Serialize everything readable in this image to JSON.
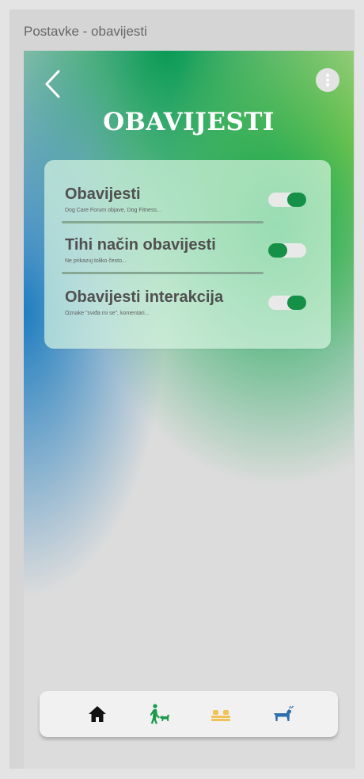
{
  "window": {
    "title": "Postavke - obavijesti"
  },
  "header": {
    "title": "OBAVIJESTI",
    "back_icon": "chevron-left-icon",
    "menu_icon": "more-vertical-icon"
  },
  "settings": {
    "items": [
      {
        "title": "Obavijesti",
        "subtitle": "Dog Care Forum objave, Dog Fitness...",
        "enabled": true
      },
      {
        "title": "Tihi način obavijesti",
        "subtitle": "Ne prikazuj toliko često...",
        "enabled": false
      },
      {
        "title": "Obavijesti interakcija",
        "subtitle": "Oznake \"sviđa mi se\", komentari...",
        "enabled": true
      }
    ]
  },
  "navbar": {
    "items": [
      {
        "icon": "home-icon",
        "color": "#111111"
      },
      {
        "icon": "dog-walking-icon",
        "color": "#1a9a4a"
      },
      {
        "icon": "dog-bed-icon",
        "color": "#f1c257"
      },
      {
        "icon": "dog-icon",
        "color": "#2e6fae"
      }
    ]
  },
  "colors": {
    "accent_green": "#149146",
    "toggle_track": "#e9e9e9"
  }
}
